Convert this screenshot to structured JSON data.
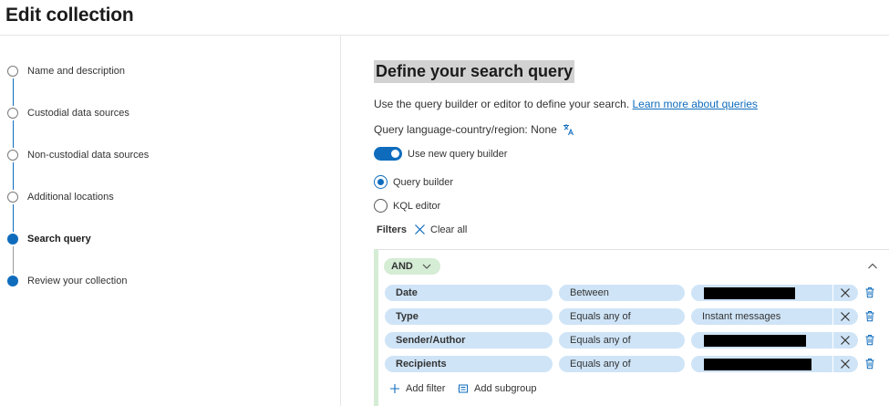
{
  "page": {
    "title": "Edit collection"
  },
  "steps": [
    {
      "label": "Name and description",
      "state": "pending"
    },
    {
      "label": "Custodial data sources",
      "state": "pending"
    },
    {
      "label": "Non-custodial data sources",
      "state": "pending"
    },
    {
      "label": "Additional locations",
      "state": "pending"
    },
    {
      "label": "Search query",
      "state": "current"
    },
    {
      "label": "Review your collection",
      "state": "upcoming"
    }
  ],
  "main": {
    "title": "Define your search query",
    "description": "Use the query builder or editor to define your search.",
    "learn_more_link": "Learn more about queries",
    "language": "Query language-country/region: None",
    "language_icon": "translate-icon",
    "toggle": {
      "label": "Use new query builder",
      "on": true
    },
    "radios": [
      {
        "label": "Query builder",
        "checked": true
      },
      {
        "label": "KQL editor",
        "checked": false
      }
    ],
    "filters_label": "Filters",
    "clear_all_label": "Clear all"
  },
  "query": {
    "group_operator": "AND",
    "conditions": [
      {
        "field": "Date",
        "operator": "Between",
        "value": "",
        "value_redacted": true
      },
      {
        "field": "Type",
        "operator": "Equals any of",
        "value": "Instant messages",
        "value_redacted": false
      },
      {
        "field": "Sender/Author",
        "operator": "Equals any of",
        "value": "",
        "value_redacted": true
      },
      {
        "field": "Recipients",
        "operator": "Equals any of",
        "value": "",
        "value_redacted": true
      }
    ],
    "add_filter_label": "Add filter",
    "add_subgroup_label": "Add subgroup"
  },
  "colors": {
    "accent": "#0f6cbd",
    "chip_bg": "#cfe4f7",
    "group_bg": "#d5ecd5"
  }
}
